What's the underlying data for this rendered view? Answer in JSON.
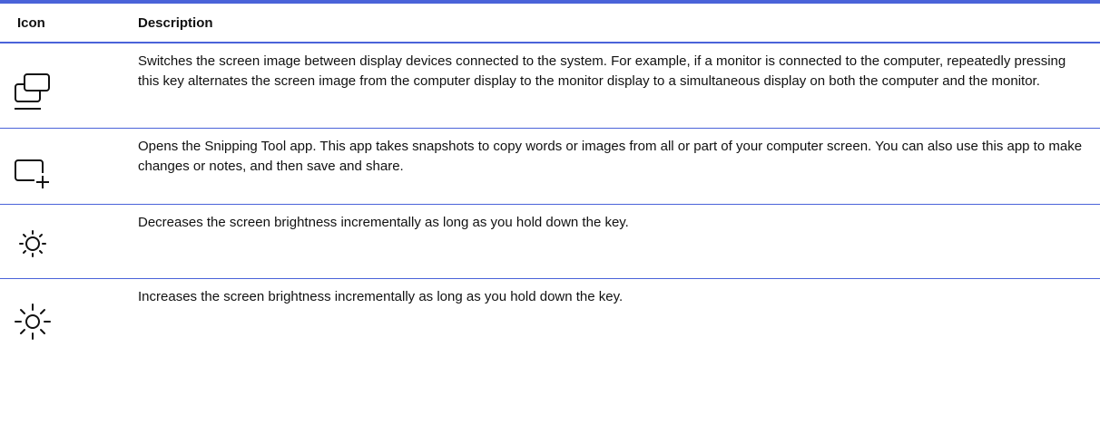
{
  "table": {
    "headers": {
      "icon": "Icon",
      "description": "Description"
    },
    "rows": [
      {
        "icon": "switch-display-icon",
        "description": "Switches the screen image between display devices connected to the system. For example, if a monitor is connected to the computer, repeatedly pressing this key alternates the screen image from the computer display to the monitor display to a simultaneous display on both the computer and the monitor."
      },
      {
        "icon": "snipping-tool-icon",
        "description": "Opens the Snipping Tool app. This app takes snapshots to copy words or images from all or part of your computer screen. You can also use this app to make changes or notes, and then save and share."
      },
      {
        "icon": "brightness-down-icon",
        "description": "Decreases the screen brightness incrementally as long as you hold down the key."
      },
      {
        "icon": "brightness-up-icon",
        "description": "Increases the screen brightness incrementally as long as you hold down the key."
      }
    ]
  },
  "colors": {
    "rule": "#4a63d9",
    "text": "#111111"
  }
}
